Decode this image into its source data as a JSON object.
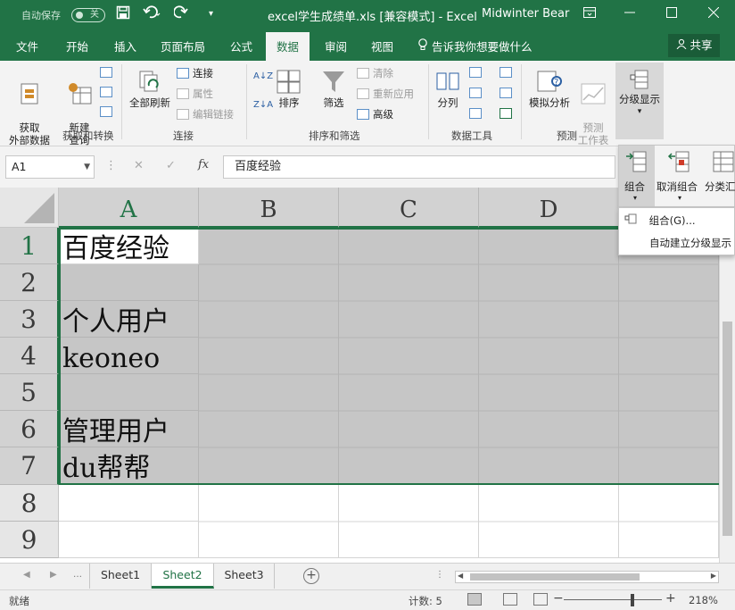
{
  "titlebar": {
    "autosave_label": "自动保存",
    "autosave_state": "关",
    "doc_title": "excel学生成绩单.xls  [兼容模式]  -  Excel",
    "user": "Midwinter Bear"
  },
  "tabs": {
    "items": [
      "文件",
      "开始",
      "插入",
      "页面布局",
      "公式",
      "数据",
      "审阅",
      "视图"
    ],
    "active": "数据",
    "tell_me": "告诉我你想要做什么",
    "share": "共享"
  },
  "ribbon": {
    "get_external": "获取\n外部数据",
    "new_query": "新建\n查询",
    "group_get_transform": "获取和转换",
    "refresh_all": "全部刷新",
    "connections": "连接",
    "properties": "属性",
    "edit_links": "编辑链接",
    "group_connections": "连接",
    "sort": "排序",
    "filter": "筛选",
    "clear": "清除",
    "reapply": "重新应用",
    "advanced": "高级",
    "group_sort_filter": "排序和筛选",
    "text_to_columns": "分列",
    "group_data_tools": "数据工具",
    "what_if": "模拟分析",
    "forecast_sheet": "预测\n工作表",
    "group_forecast": "预测",
    "outline": "分级显示"
  },
  "formula_bar": {
    "name_box": "A1",
    "formula": "百度经验"
  },
  "outline_dropdown": {
    "group": "组合",
    "ungroup": "取消组合",
    "subtotal": "分类汇",
    "menu_group": "组合(G)...",
    "menu_auto_outline": "自动建立分级显示"
  },
  "grid": {
    "columns": [
      "A",
      "B",
      "C",
      "D",
      ""
    ],
    "rows": [
      "1",
      "2",
      "3",
      "4",
      "5",
      "6",
      "7",
      "8",
      "9"
    ],
    "cells_a": [
      "百度经验",
      "",
      "个人用户",
      "keoneo",
      "",
      "管理用户",
      "du帮帮",
      "",
      ""
    ]
  },
  "sheets": {
    "items": [
      "Sheet1",
      "Sheet2",
      "Sheet3"
    ],
    "active": "Sheet2"
  },
  "status": {
    "mode": "就绪",
    "count_label": "计数: 5",
    "zoom_level": "218%"
  },
  "colors": {
    "accent": "#217346",
    "selection": "#c6c6c6"
  }
}
